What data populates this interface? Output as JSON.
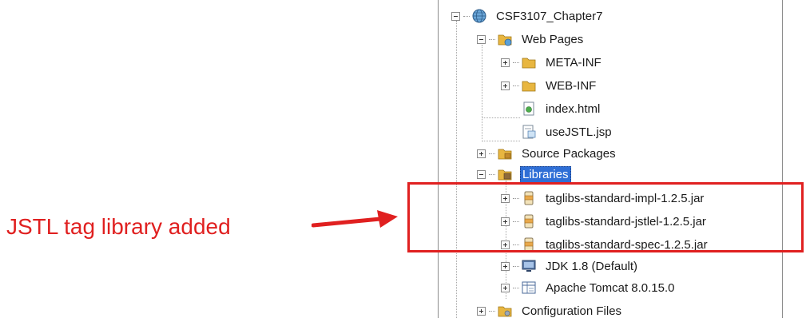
{
  "tree": {
    "nodes": [
      {
        "label": "CSF3107_Chapter7",
        "icon": "web-project-icon",
        "state": "expanded"
      },
      {
        "label": "Web Pages",
        "icon": "web-pages-folder-icon",
        "state": "expanded"
      },
      {
        "label": "META-INF",
        "icon": "folder-icon",
        "state": "collapsed"
      },
      {
        "label": "WEB-INF",
        "icon": "folder-icon",
        "state": "collapsed"
      },
      {
        "label": "index.html",
        "icon": "html-file-icon",
        "state": "leaf"
      },
      {
        "label": "useJSTL.jsp",
        "icon": "jsp-file-icon",
        "state": "leaf"
      },
      {
        "label": "Source Packages",
        "icon": "source-packages-icon",
        "state": "collapsed"
      },
      {
        "label": "Libraries",
        "icon": "libraries-folder-icon",
        "state": "expanded",
        "selected": true
      },
      {
        "label": "taglibs-standard-impl-1.2.5.jar",
        "icon": "jar-file-icon",
        "state": "collapsed"
      },
      {
        "label": "taglibs-standard-jstlel-1.2.5.jar",
        "icon": "jar-file-icon",
        "state": "collapsed"
      },
      {
        "label": "taglibs-standard-spec-1.2.5.jar",
        "icon": "jar-file-icon",
        "state": "collapsed"
      },
      {
        "label": "JDK 1.8 (Default)",
        "icon": "jdk-icon",
        "state": "collapsed"
      },
      {
        "label": "Apache Tomcat 8.0.15.0",
        "icon": "server-library-icon",
        "state": "collapsed"
      },
      {
        "label": "Configuration Files",
        "icon": "configuration-folder-icon",
        "state": "collapsed"
      }
    ]
  },
  "annotation": {
    "text": "JSTL tag library added",
    "color": "#e02020"
  },
  "colors": {
    "selection": "#2f6fd6",
    "folder": "#e8b640"
  }
}
